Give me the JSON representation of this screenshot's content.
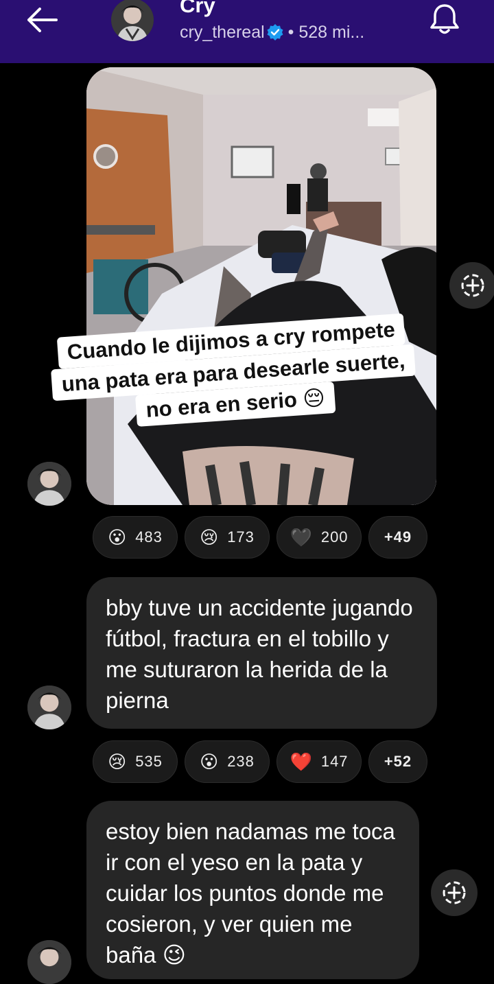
{
  "header": {
    "name": "Cry",
    "handle": "cry_thereal",
    "meta": "• 528 mi..."
  },
  "colors": {
    "header_bg": "#2a0f72",
    "bubble_bg": "#262626",
    "verified": "#1d9bf0"
  },
  "messages": [
    {
      "type": "photo",
      "caption_lines": [
        "Cuando le dijimos a cry rompete",
        "una pata era para desearle suerte,",
        "no era en serio 😔"
      ],
      "reactions": [
        {
          "emoji": "😮",
          "count": "483"
        },
        {
          "emoji": "😢",
          "count": "173"
        },
        {
          "emoji": "🖤",
          "count": "200"
        }
      ],
      "more": "+49"
    },
    {
      "type": "text",
      "text": "bby tuve un accidente jugando fútbol, fractura en el tobillo y me suturaron la herida de la pierna",
      "reactions": [
        {
          "emoji": "😢",
          "count": "535"
        },
        {
          "emoji": "😮",
          "count": "238"
        },
        {
          "emoji": "❤️",
          "count": "147"
        }
      ],
      "more": "+52"
    },
    {
      "type": "text",
      "text": "estoy bien nadamas me toca ir con el yeso en la pata y cuidar los puntos donde me cosieron, y ver quien me baña 😉"
    }
  ],
  "icons": {
    "back": "back-arrow-icon",
    "bell": "bell-icon",
    "add_reaction": "add-reaction-icon",
    "verified": "verified-badge-icon"
  }
}
